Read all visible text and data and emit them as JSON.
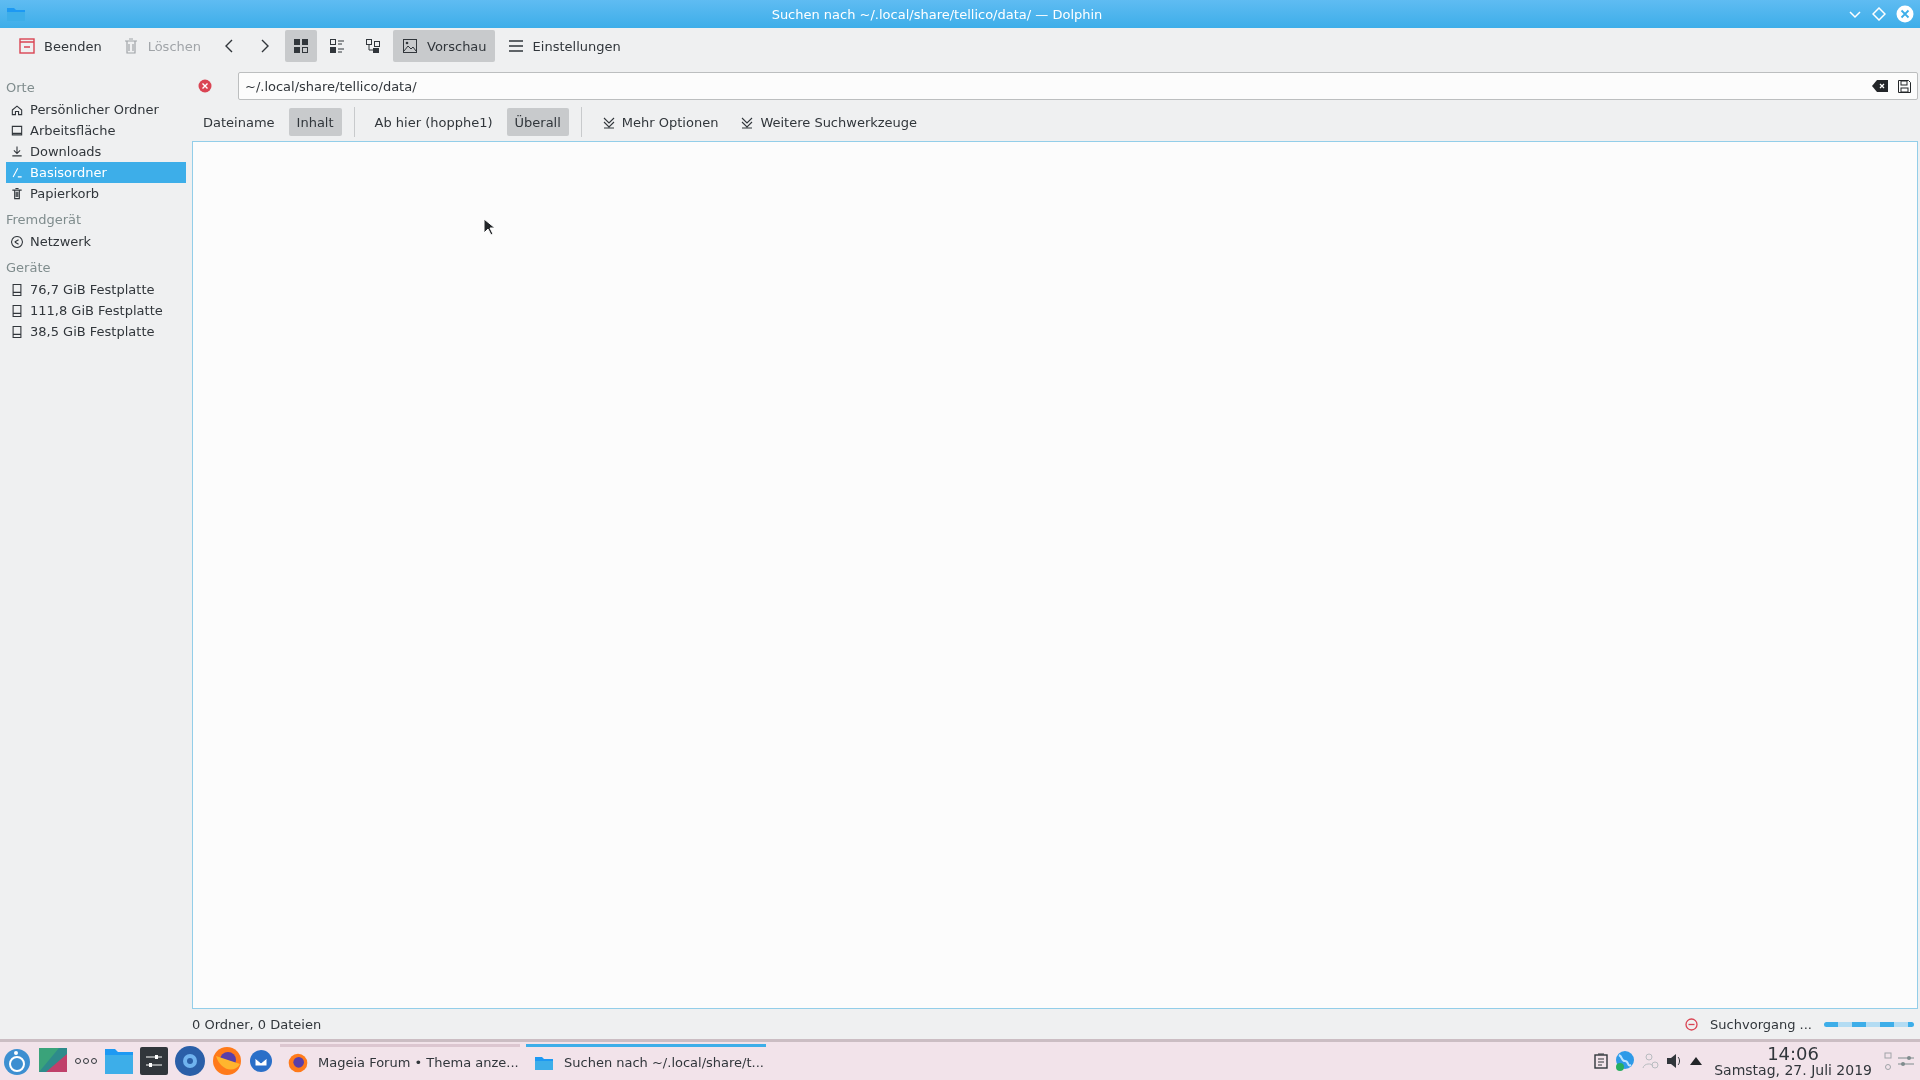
{
  "window": {
    "title": "Suchen nach ~/.local/share/tellico/data/ — Dolphin"
  },
  "toolbar": {
    "quit": {
      "label": "Beenden"
    },
    "delete": {
      "label": "Löschen",
      "disabled": true
    },
    "view_modes": [
      {
        "selected": true
      },
      {
        "selected": false
      },
      {
        "selected": false
      }
    ],
    "preview": {
      "label": "Vorschau",
      "selected": true
    },
    "settings": {
      "label": "Einstellungen"
    }
  },
  "sidebar": [
    {
      "heading": "Orte",
      "items": [
        {
          "label": "Persönlicher Ordner",
          "selected": false
        },
        {
          "label": "Arbeitsfläche",
          "selected": false
        },
        {
          "label": "Downloads",
          "selected": false
        },
        {
          "label": "Basisordner",
          "selected": true
        },
        {
          "label": "Papierkorb",
          "selected": false
        }
      ]
    },
    {
      "heading": "Fremdgerät",
      "items": [
        {
          "label": "Netzwerk",
          "selected": false
        }
      ]
    },
    {
      "heading": "Geräte",
      "items": [
        {
          "label": "76,7 GiB Festplatte",
          "selected": false
        },
        {
          "label": "111,8 GiB Festplatte",
          "selected": false
        },
        {
          "label": "38,5 GiB Festplatte",
          "selected": false
        }
      ]
    }
  ],
  "search": {
    "value": "~/.local/share/tellico/data/"
  },
  "filters": [
    {
      "group": [
        {
          "label": "Dateiname",
          "selected": false
        },
        {
          "label": "Inhalt",
          "selected": true
        }
      ]
    },
    {
      "group": [
        {
          "label": "Ab hier (hopphe1)",
          "selected": false
        },
        {
          "label": "Überall",
          "selected": true
        }
      ]
    }
  ],
  "options": [
    {
      "label": "Mehr Optionen"
    },
    {
      "label": "Weitere Suchwerkzeuge"
    }
  ],
  "status_bar": {
    "summary": "0 Ordner, 0 Dateien",
    "progress_text": "Suchvorgang ..."
  },
  "taskbar": {
    "tasks": [
      {
        "label": "Mageia Forum • Thema anze...",
        "selected": false
      },
      {
        "label": "Suchen nach ~/.local/share/t...",
        "selected": true
      }
    ],
    "clock": {
      "time": "14:06",
      "date": "Samstag, 27. Juli 2019"
    }
  }
}
